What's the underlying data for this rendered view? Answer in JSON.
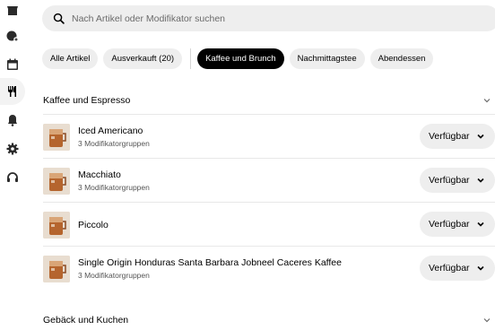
{
  "sidebar": {
    "icons": [
      "store-icon",
      "tag-discount-icon",
      "calendar-icon",
      "menu-utensils-icon",
      "bell-icon",
      "gear-icon",
      "headset-icon"
    ],
    "active": "menu-utensils-icon"
  },
  "search": {
    "placeholder": "Nach Artikel oder Modifikator suchen"
  },
  "filters": {
    "chips": [
      "Alle Artikel",
      "Ausverkauft (20)"
    ],
    "menus": [
      "Kaffee und Brunch",
      "Nachmittagstee",
      "Abendessen"
    ],
    "active": "Kaffee und Brunch"
  },
  "sections": [
    {
      "title": "Kaffee und Espresso",
      "items": [
        {
          "name": "Iced Americano",
          "sub": "3 Modifikatorgruppen",
          "status": "Verfügbar"
        },
        {
          "name": "Macchiato",
          "sub": "3 Modifikatorgruppen",
          "status": "Verfügbar"
        },
        {
          "name": "Piccolo",
          "sub": "",
          "status": "Verfügbar"
        },
        {
          "name": "Single Origin Honduras Santa Barbara Jobneel Caceres Kaffee",
          "sub": "3 Modifikatorgruppen",
          "status": "Verfügbar"
        }
      ]
    },
    {
      "title": "Gebäck und Kuchen",
      "items": []
    }
  ],
  "colors": {
    "accent": "#000000",
    "chip_bg": "#eeeeee",
    "divider": "#e8e8e8"
  }
}
